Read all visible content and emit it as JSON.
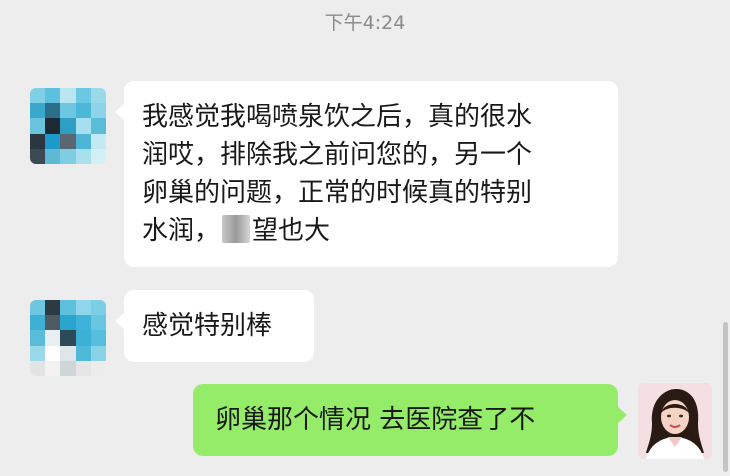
{
  "timestamp": "下午4:24",
  "messages": [
    {
      "side": "left",
      "lines": [
        "我感觉我喝喷泉饮之后，真的很水",
        "润哎，排除我之前问您的，另一个",
        "卵巢的问题，正常的时候真的特别"
      ],
      "last_line_before": "水润，",
      "last_line_after": "望也大"
    },
    {
      "side": "left",
      "text": "感觉特别棒"
    },
    {
      "side": "right",
      "text": "卵巢那个情况 去医院查了不"
    }
  ],
  "avatars": {
    "contact_1": "pixelated-avatar-icon",
    "contact_2": "pixelated-avatar-icon",
    "self": "user-photo-avatar"
  },
  "colors": {
    "background": "#ededed",
    "incoming_bubble": "#ffffff",
    "outgoing_bubble": "#95ec69",
    "timestamp": "#8a8a8a"
  }
}
